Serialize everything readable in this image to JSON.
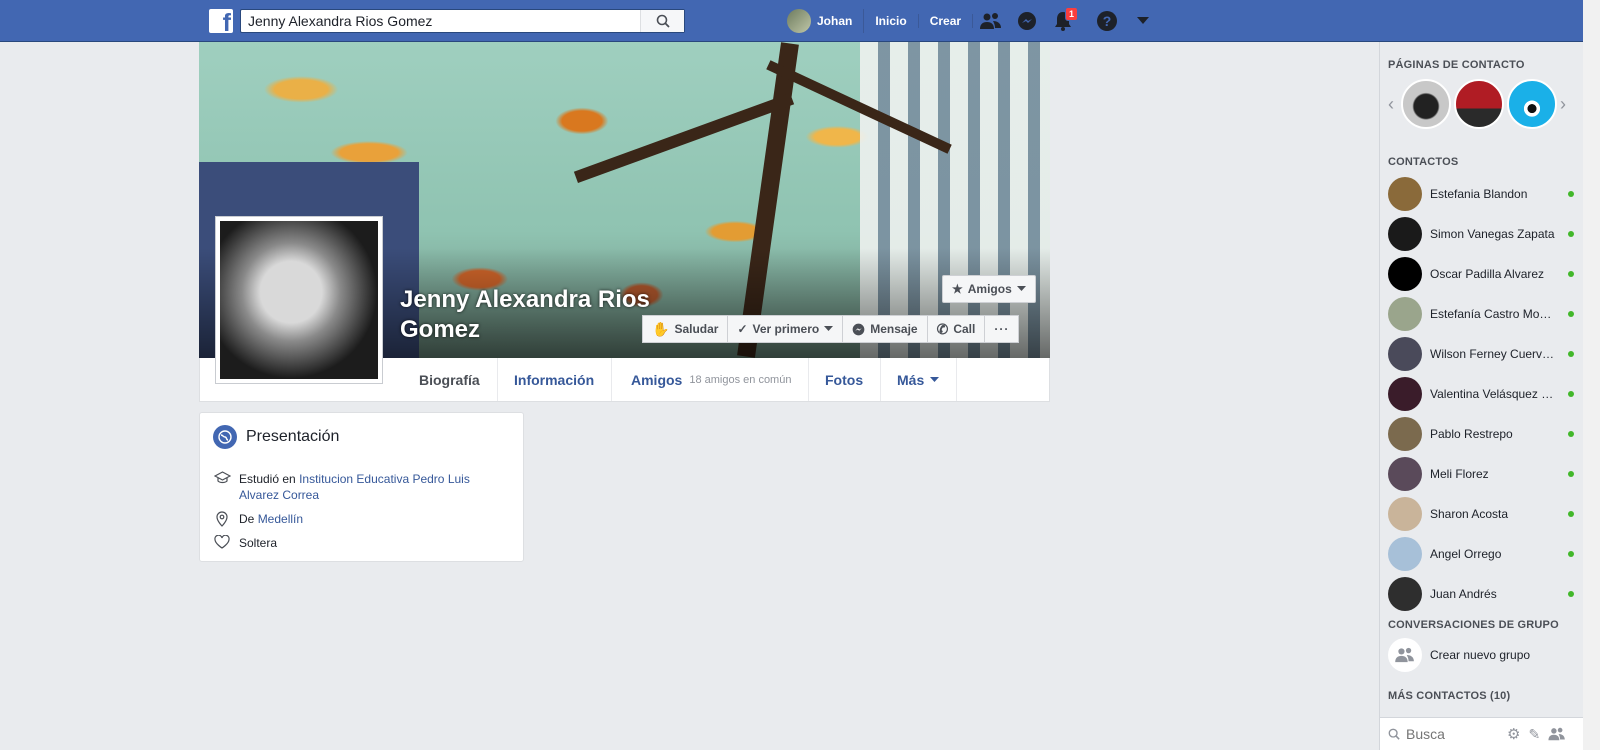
{
  "topbar": {
    "logo_letter": "f",
    "search_value": "Jenny Alexandra Rios Gomez",
    "user_name": "Johan",
    "nav_links": [
      "Inicio",
      "Crear"
    ],
    "notification_count": "1"
  },
  "profile": {
    "name": "Jenny Alexandra Rios Gomez",
    "friend_button": "Amigos",
    "actions": {
      "saludar": "Saludar",
      "ver_primero": "Ver primero",
      "mensaje": "Mensaje",
      "call": "Call"
    },
    "tabs": {
      "biografia": "Biografía",
      "informacion": "Información",
      "amigos": "Amigos",
      "amigos_sub": "18 amigos en común",
      "fotos": "Fotos",
      "mas": "Más"
    }
  },
  "intro": {
    "title": "Presentación",
    "studied_prefix": "Estudió en",
    "studied_school": "Institucion Educativa Pedro Luis Alvarez Correa",
    "from_prefix": "De",
    "from_city": "Medellín",
    "relationship": "Soltera"
  },
  "sidebar": {
    "pages_heading": "PÁGINAS DE CONTACTO",
    "contacts_heading": "CONTACTOS",
    "contacts": [
      "Estefania Blandon",
      "Simon Vanegas Zapata",
      "Oscar Padilla Alvarez",
      "Estefanía Castro Mo…",
      "Wilson Ferney Cuerv…",
      "Valentina Velásquez …",
      "Pablo Restrepo",
      "Meli Florez",
      "Sharon Acosta",
      "Angel Orrego",
      "Juan Andrés"
    ],
    "groups_heading": "CONVERSACIONES DE GRUPO",
    "new_group": "Crear nuevo grupo",
    "more_contacts": "MÁS CONTACTOS (10)",
    "search_placeholder": "Busca"
  },
  "colors": {
    "brand": "#4267b2",
    "link": "#365899",
    "online": "#42b72a",
    "badge": "#fa3e3e"
  }
}
